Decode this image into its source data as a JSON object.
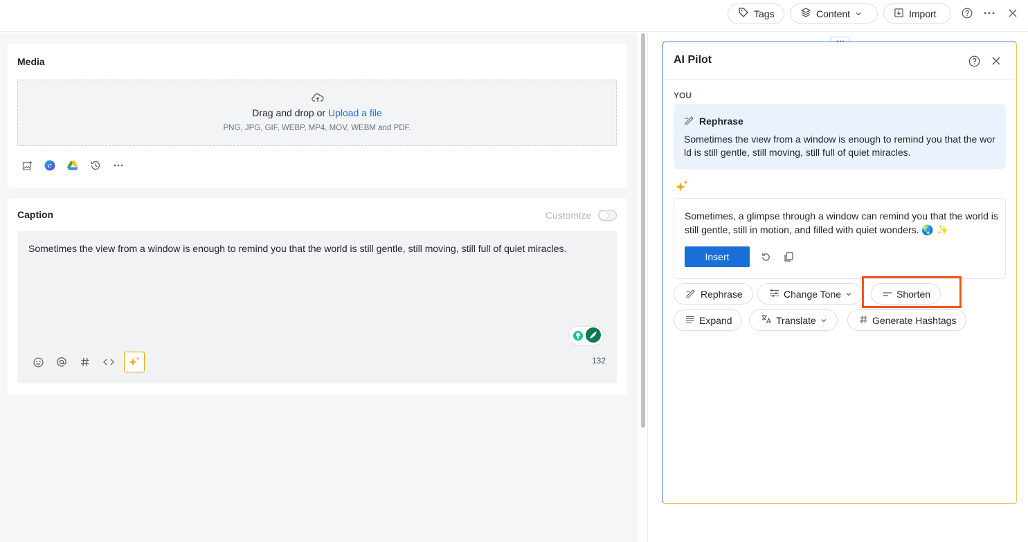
{
  "topbar": {
    "tags_label": "Tags",
    "content_label": "Content",
    "import_label": "Import"
  },
  "media": {
    "title": "Media",
    "drop_text": "Drag and drop or",
    "upload_link": "Upload a file",
    "formats": "PNG, JPG, GIF, WEBP, MP4, MOV, WEBM and PDF."
  },
  "caption": {
    "title": "Caption",
    "customize_label": "Customize",
    "text": "Sometimes the view from a window is enough to remind you that the world is still gentle, still moving, still full of quiet miracles.",
    "char_count": "132"
  },
  "ai_pilot": {
    "title": "AI Pilot",
    "you_label": "YOU",
    "request_action": "Rephrase",
    "request_text": "Sometimes the view from a window is enough to remind you that the world is still gentle, still moving, still full of quiet miracles.",
    "response_text": "Sometimes, a glimpse through a window can remind you that the world is still gentle, still in motion, and filled with quiet wonders. 🌏 ✨",
    "insert_label": "Insert",
    "actions": {
      "rephrase": "Rephrase",
      "change_tone": "Change Tone",
      "shorten": "Shorten",
      "expand": "Expand",
      "translate": "Translate",
      "generate_hashtags": "Generate Hashtags"
    }
  },
  "colors": {
    "accent": "#1a6ed8",
    "highlight": "#f2561b",
    "sparkle": "#f5a623"
  }
}
